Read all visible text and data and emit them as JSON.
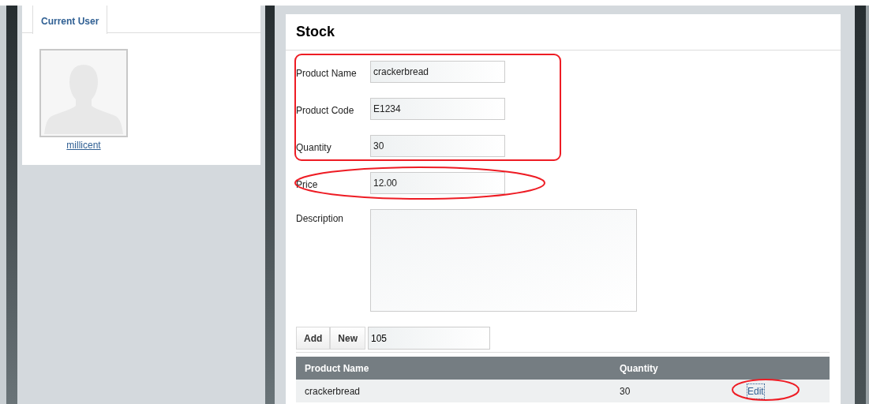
{
  "sidebar": {
    "tab": {
      "label": "Current User",
      "selected": true
    },
    "user": {
      "name": "millicent"
    }
  },
  "panel": {
    "title": "Stock",
    "fields": [
      {
        "label": "Product Name",
        "value": "crackerbread"
      },
      {
        "label": "Product Code",
        "value": "E1234"
      },
      {
        "label": "Quantity",
        "value": "30"
      },
      {
        "label": "Price",
        "value": "12.00"
      },
      {
        "label": "Description",
        "kind": "textarea"
      }
    ],
    "buttons": [
      "Add",
      "New"
    ],
    "id_field": {
      "value": "105"
    },
    "table": {
      "columns": [
        "Product Name",
        "Quantity"
      ],
      "rows": [
        {
          "cells": [
            "crackerbread",
            "30"
          ],
          "action": "Edit"
        }
      ]
    }
  }
}
